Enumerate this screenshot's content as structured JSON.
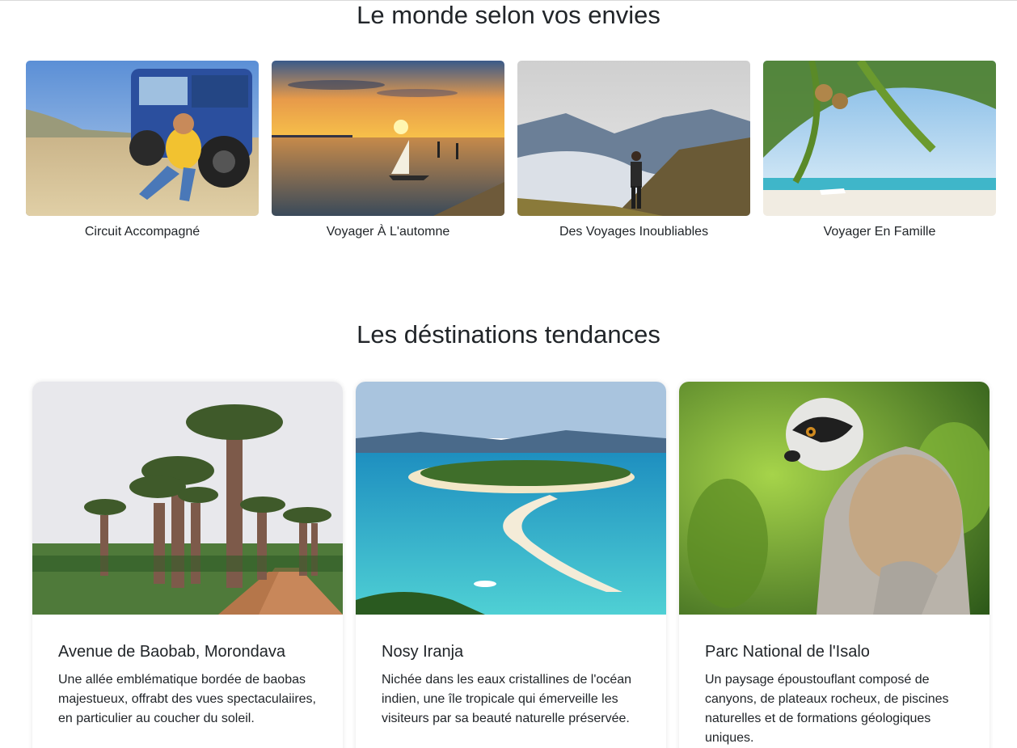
{
  "section_envies": {
    "title": "Le monde selon vos envies",
    "categories": [
      {
        "label": "Circuit Accompagné",
        "image": "woman-with-binoculars-by-jeep"
      },
      {
        "label": "Voyager À L'automne",
        "image": "sunset-with-sailboat"
      },
      {
        "label": "Des Voyages Inoubliables",
        "image": "hiker-on-misty-mountains"
      },
      {
        "label": "Voyager En Famille",
        "image": "tropical-beach-with-palm"
      }
    ]
  },
  "section_tendances": {
    "title": "Les déstinations tendances",
    "cards": [
      {
        "title": "Avenue de Baobab, Morondava",
        "text": "Une allée emblématique bordée de baobas majestueux, offrabt des vues spectaculaiires, en particulier au coucher du soleil.",
        "image": "baobab-avenue"
      },
      {
        "title": "Nosy Iranja",
        "text": "Nichée dans les eaux cristallines de l'océan indien, une île tropicale qui émerveille les visiteurs par sa beauté naturelle préservée.",
        "image": "tropical-island-sandbank"
      },
      {
        "title": "Parc National de l'Isalo",
        "text": "Un paysage époustouflant composé de canyons, de plateaux rocheux, de piscines naturelles et de formations géologiques uniques.",
        "image": "ring-tailed-lemur"
      }
    ]
  }
}
